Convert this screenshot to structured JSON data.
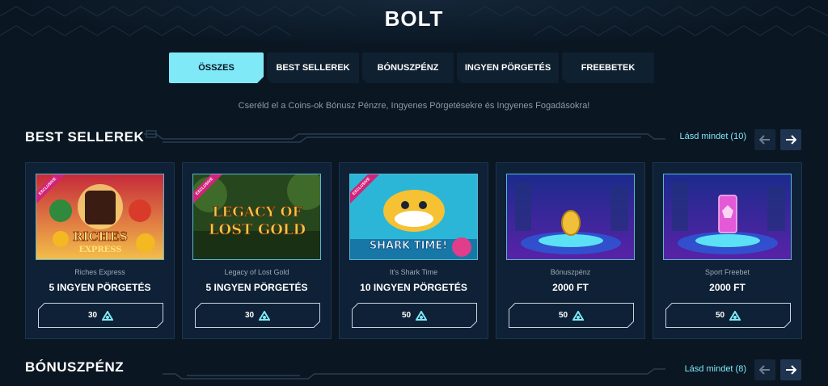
{
  "page": {
    "title": "BOLT"
  },
  "tabs": [
    {
      "label": "ÖSSZES",
      "active": true
    },
    {
      "label": "BEST SELLEREK",
      "active": false
    },
    {
      "label": "BÓNUSZPÉNZ",
      "active": false
    },
    {
      "label": "INGYEN PÖRGETÉS",
      "active": false
    },
    {
      "label": "FREEBETEK",
      "active": false
    }
  ],
  "subtitle": "Cseréld el a Coins-ok Bónusz Pénzre, Ingyenes Pörgetésekre és Ingyenes Fogadásokra!",
  "sections": [
    {
      "title": "BEST SELLEREK",
      "see_all": "Lásd mindet (10)",
      "cards": [
        {
          "name": "Riches Express",
          "value": "5 INGYEN PÖRGETÉS",
          "price": "30",
          "badge": "EXCLUSIVE",
          "image": "riches-express-game-art"
        },
        {
          "name": "Legacy of Lost Gold",
          "value": "5 INGYEN PÖRGETÉS",
          "price": "30",
          "badge": "EXCLUSIVE",
          "image": "legacy-of-lost-gold-game-art"
        },
        {
          "name": "It's Shark Time",
          "value": "10 INGYEN PÖRGETÉS",
          "price": "50",
          "badge": "EXCLUSIVE",
          "image": "shark-time-game-art"
        },
        {
          "name": "Bónuszpénz",
          "value": "2000 FT",
          "price": "50",
          "badge": "",
          "image": "gold-coin-pedestal"
        },
        {
          "name": "Sport Freebet",
          "value": "2000 FT",
          "price": "50",
          "badge": "",
          "image": "pink-ticket-pedestal"
        }
      ]
    },
    {
      "title": "BÓNUSZPÉNZ",
      "see_all": "Lásd mindet (8)"
    }
  ],
  "icons": {
    "prev": "arrow-left-icon",
    "next": "arrow-right-icon",
    "currency": "coin-icon"
  },
  "colors": {
    "accent": "#7fe9f7",
    "background": "#0a1622",
    "card": "#0e2136",
    "badge": "#d2237a"
  }
}
